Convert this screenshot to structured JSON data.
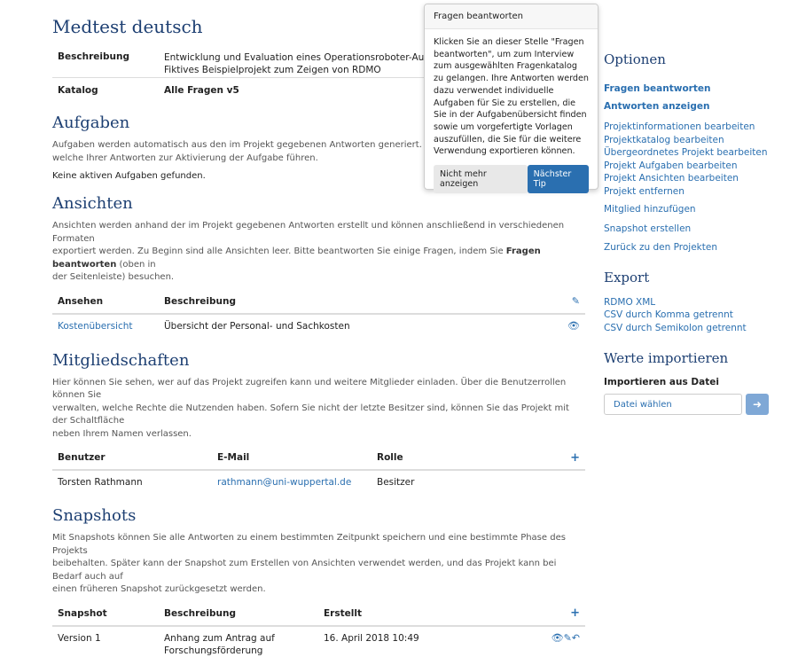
{
  "project": {
    "title": "Medtest deutsch",
    "desc_label": "Beschreibung",
    "desc_line1": "Entwicklung und Evaluation eines Operationsroboter-Aufsatzes zur",
    "desc_line2": "Fiktives Beispielprojekt zum Zeigen von RDMO",
    "catalog_label": "Katalog",
    "catalog_value": "Alle Fragen v5"
  },
  "tasks": {
    "title": "Aufgaben",
    "text_line1": "Aufgaben werden automatisch aus den im Projekt gegebenen Antworten generiert. Auf der Sei",
    "text_line2": "welche Ihrer Antworten zur Aktivierung der Aufgabe führen.",
    "empty": "Keine aktiven Aufgaben gefunden."
  },
  "views": {
    "title": "Ansichten",
    "text_line1": "Ansichten werden anhand der im Projekt gegebenen Antworten erstellt und können anschließend in verschiedenen Formaten",
    "text_line2_pre": "exportiert werden. Zu Beginn sind alle Ansichten leer. Bitte beantworten Sie einige Fragen, indem Sie ",
    "text_line2_bold": "Fragen beantworten",
    "text_line2_post": " (oben in",
    "text_line3": "der Seitenleiste) besuchen.",
    "col1": "Ansehen",
    "col2": "Beschreibung",
    "rows": [
      {
        "name": "Kostenübersicht",
        "desc": "Übersicht der Personal- und Sachkosten"
      }
    ]
  },
  "memberships": {
    "title": "Mitgliedschaften",
    "text_line1": "Hier können Sie sehen, wer auf das Projekt zugreifen kann und weitere Mitglieder einladen. Über die Benutzerrollen können Sie",
    "text_line2": "verwalten, welche Rechte die Nutzenden haben. Sofern Sie nicht der letzte Besitzer sind, können Sie das Projekt mit der Schaltfläche",
    "text_line3": "neben Ihrem Namen verlassen.",
    "col1": "Benutzer",
    "col2": "E-Mail",
    "col3": "Rolle",
    "rows": [
      {
        "user": "Torsten Rathmann",
        "email": "rathmann@uni-wuppertal.de",
        "role": "Besitzer"
      }
    ]
  },
  "snapshots": {
    "title": "Snapshots",
    "text_line1": "Mit Snapshots können Sie alle Antworten zu einem bestimmten Zeitpunkt speichern und eine bestimmte Phase des Projekts",
    "text_line2": "beibehalten. Später kann der Snapshot zum Erstellen von Ansichten verwendet werden, und das Projekt kann bei Bedarf auch auf",
    "text_line3": "einen früheren Snapshot zurückgesetzt werden.",
    "col1": "Snapshot",
    "col2": "Beschreibung",
    "col3": "Erstellt",
    "rows": [
      {
        "name": "Version 1",
        "desc_line1": "Anhang zum Antrag auf",
        "desc_line2": "Forschungsförderung",
        "created": "16. April 2018 10:49"
      }
    ]
  },
  "sidebar": {
    "options_title": "Optionen",
    "answer_questions": "Fragen beantworten",
    "show_answers": "Antworten anzeigen",
    "links": [
      "Projektinformationen bearbeiten",
      "Projektkatalog bearbeiten",
      "Übergeordnetes Projekt bearbeiten",
      "Projekt Aufgaben bearbeiten",
      "Projekt Ansichten bearbeiten",
      "Projekt entfernen"
    ],
    "add_member": "Mitglied hinzufügen",
    "create_snapshot": "Snapshot erstellen",
    "back_to_projects": "Zurück zu den Projekten",
    "export_title": "Export",
    "export_links": [
      "RDMO XML",
      "CSV durch Komma getrennt",
      "CSV durch Semikolon getrennt"
    ],
    "import_title": "Werte importieren",
    "import_label": "Importieren aus Datei",
    "file_button": "Datei wählen"
  },
  "popover": {
    "title": "Fragen beantworten",
    "body": "Klicken Sie an dieser Stelle \"Fragen beantworten\", um zum Interview zum ausgewählten Fragenkatalog zu gelangen. Ihre Antworten werden dazu verwendet individuelle Aufgaben für Sie zu erstellen, die Sie in der Aufgabenübersicht finden sowie um vorgefertigte Vorlagen auszufüllen, die Sie für die weitere Verwendung exportieren können.",
    "dismiss": "Nicht mehr anzeigen",
    "next": "Nächster Tip"
  },
  "colors": {
    "heading": "#1d3f72",
    "link": "#2a6fb0",
    "primary_button": "#2a6fb0",
    "import_button": "#7fa8d6"
  }
}
